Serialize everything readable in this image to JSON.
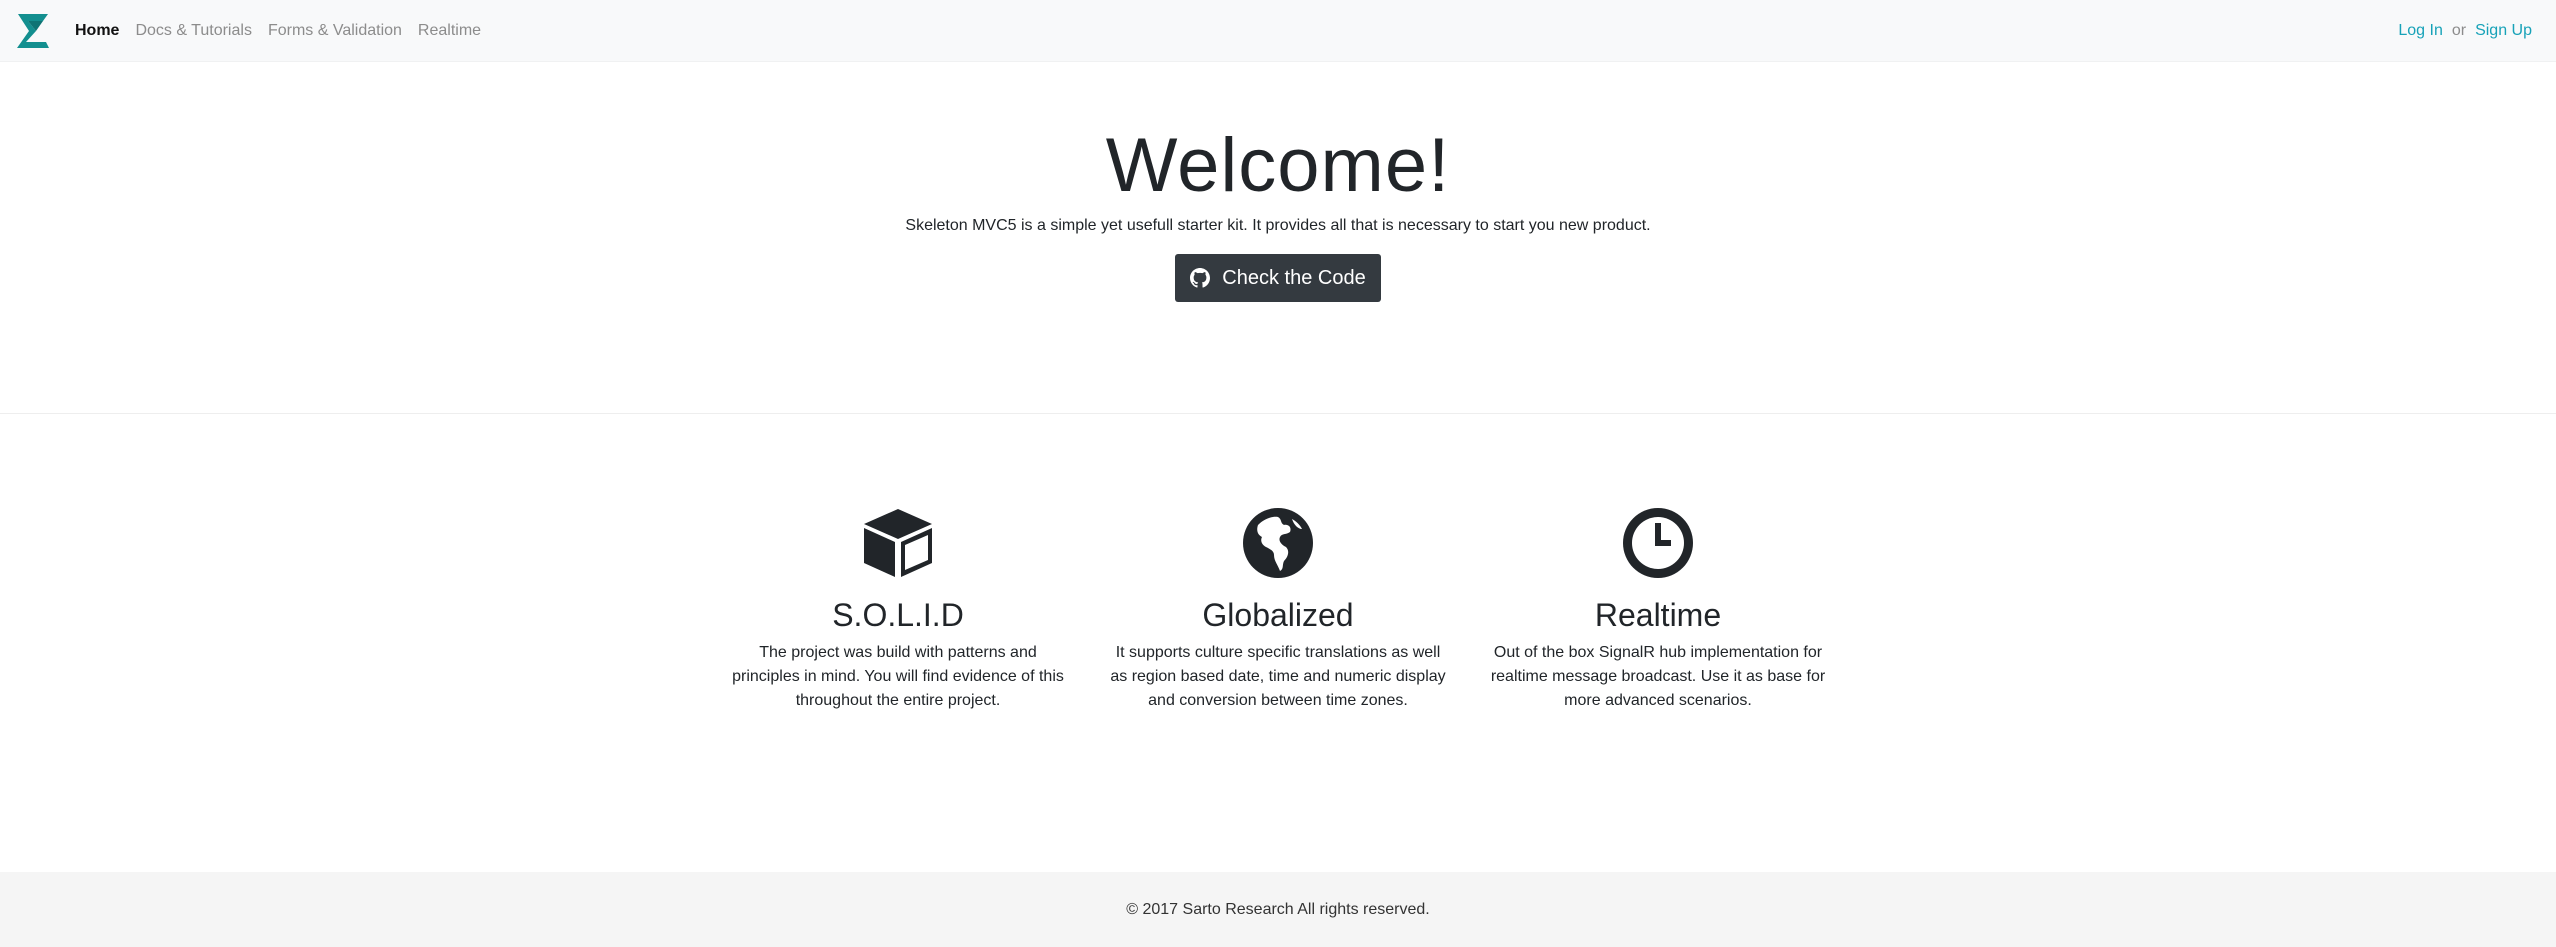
{
  "navbar": {
    "brand_logo": "skeleton-s-logo",
    "links": [
      {
        "label": "Home",
        "active": true
      },
      {
        "label": "Docs & Tutorials",
        "active": false
      },
      {
        "label": "Forms & Validation",
        "active": false
      },
      {
        "label": "Realtime",
        "active": false
      }
    ],
    "auth": {
      "login_label": "Log In",
      "or_label": "or",
      "signup_label": "Sign Up"
    }
  },
  "hero": {
    "title": "Welcome!",
    "lead": "Skeleton MVC5 is a simple yet usefull starter kit. It provides all that is necessary to start you new product.",
    "button_label": "Check the Code",
    "button_icon": "github-icon"
  },
  "features": [
    {
      "icon": "cube-icon",
      "title": "S.O.L.I.D",
      "text": "The project was build with patterns and principles in mind. You will find evidence of this throughout the entire project."
    },
    {
      "icon": "globe-icon",
      "title": "Globalized",
      "text": "It supports culture specific translations as well as region based date, time and numeric display and conversion between time zones."
    },
    {
      "icon": "clock-icon",
      "title": "Realtime",
      "text": "Out of the box SignalR hub implementation for realtime message broadcast. Use it as base for more advanced scenarios."
    }
  ],
  "footer": {
    "text": "© 2017 Sarto Research All rights reserved."
  },
  "colors": {
    "accent": "#17a2b8",
    "logo": "#138f8f",
    "button_bg": "#343a40",
    "navbar_bg": "#f8f9fa",
    "footer_bg": "#f5f5f5"
  }
}
